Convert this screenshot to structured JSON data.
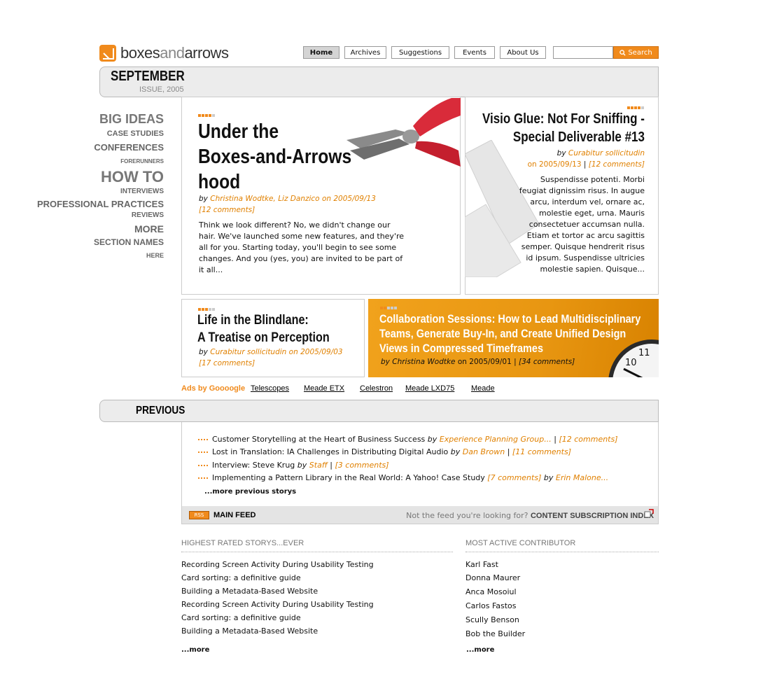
{
  "logo": {
    "text_a": "boxes",
    "text_b": "and",
    "text_c": "arrows"
  },
  "nav": {
    "items": [
      {
        "label": "Home",
        "active": true
      },
      {
        "label": "Archives"
      },
      {
        "label": "Suggestions"
      },
      {
        "label": "Events"
      },
      {
        "label": "About Us"
      }
    ],
    "search_value": "",
    "search_button": "Search"
  },
  "issue": {
    "month": "SEPTEMBER",
    "issue": "ISSUE, 2005"
  },
  "sidebar": {
    "items": [
      "BIG IDEAS",
      "CASE STUDIES",
      "CONFERENCES",
      "FORERUNNERS",
      "HOW TO",
      "INTERVIEWS",
      "PROFESSIONAL PRACTICES",
      "REVIEWS",
      "MORE",
      "SECTION NAMES",
      "HERE"
    ]
  },
  "lead": {
    "title_1": "Under the",
    "title_2": "Boxes-and-Arrows",
    "title_3": "hood",
    "by": "by",
    "authors": "Christina Wodtke, Liz Danzico on 2005/09/13",
    "comments": "[12 comments]",
    "body": "Think we look different? No, we didn't change our hair. We've launched some new features, and they're all for you. Starting today, you'll begin to see some changes. And you (yes, you) are invited to be part of it all..."
  },
  "visio": {
    "title_1": "Visio Glue: Not For Sniffing -",
    "title_2": "Special Deliverable #13",
    "by": "by",
    "author": "Curabitur sollicitudin",
    "date": "on 2005/09/13",
    "sep": "|",
    "comments": "[12 comments]",
    "body": "Suspendisse potenti. Morbi feugiat dignissim risus. In augue arcu, interdum vel, ornare ac, molestie eget, urna. Mauris consectetuer accumsan nulla. Etiam et tortor ac arcu sagittis semper. Quisque hendrerit risus id ipsum. Suspendisse ultricies molestie sapien. Quisque..."
  },
  "blindlane": {
    "title_1": "Life in the Blindlane:",
    "title_2": "A Treatise on Perception",
    "by": "by",
    "author_date": "Curabitur sollicitudin on 2005/09/03",
    "comments": "[17 comments]"
  },
  "collab": {
    "title_1": "Collaboration Sessions: How to Lead Multidisciplinary",
    "title_2": "Teams, Generate Buy-In, and Create Unified Design",
    "title_3": "Views in Compressed Timeframes",
    "by": "by",
    "author": "Christina Wodtke",
    "date": "on 2005/09/01",
    "sep": "|",
    "comments": "[34 comments]",
    "clock_11": "11",
    "clock_10": "10"
  },
  "ads": {
    "label": "Ads by Goooogle",
    "links": [
      "Telescopes",
      "Meade ETX",
      "Celestron",
      "Meade LXD75",
      "Meade"
    ]
  },
  "previous": {
    "title": "PREVIOUS",
    "items": [
      {
        "title": "Customer Storytelling at the Heart of Business Success",
        "by": "by",
        "author": "Experience Planning Group...",
        "sep": "|",
        "comments": "[12 comments]"
      },
      {
        "title": "Lost in Translation: IA Challenges in Distributing Digital Audio",
        "by": "by",
        "author": "Dan Brown",
        "sep": "|",
        "comments": "[11 comments]"
      },
      {
        "title": "Interview: Steve Krug",
        "by": "by",
        "author": "Staff",
        "sep": "|",
        "comments": "[3 comments]"
      },
      {
        "title": "Implementing a Pattern Library in the Real World: A Yahoo! Case Study",
        "comments": "[7 comments]",
        "by": "by",
        "author": "Erin Malone..."
      }
    ],
    "more": "...more previous storys"
  },
  "feed": {
    "rss": "RSS",
    "main": "MAIN FEED",
    "question": "Not the feed you're looking for?",
    "index": "CONTENT SUBSCRIPTION INDEX"
  },
  "highest": {
    "heading": "HIGHEST RATED STORYS...EVER",
    "items": [
      "Recording Screen Activity During Usability Testing",
      "Card sorting: a definitive guide",
      "Building a Metadata-Based Website",
      "Recording Screen Activity During Usability Testing",
      "Card sorting: a definitive guide",
      "Building a Metadata-Based Website"
    ],
    "more": "...more"
  },
  "active": {
    "heading": "MOST ACTIVE CONTRIBUTOR",
    "items": [
      "Karl Fast",
      "Donna Maurer",
      "Anca Mosoiul",
      "Carlos Fastos",
      "Scully Benson",
      "Bob the Builder"
    ],
    "more": "...more"
  },
  "colors": {
    "accent": "#f08a1c",
    "link_orange": "#e08000",
    "panel_gray": "#ececec"
  }
}
